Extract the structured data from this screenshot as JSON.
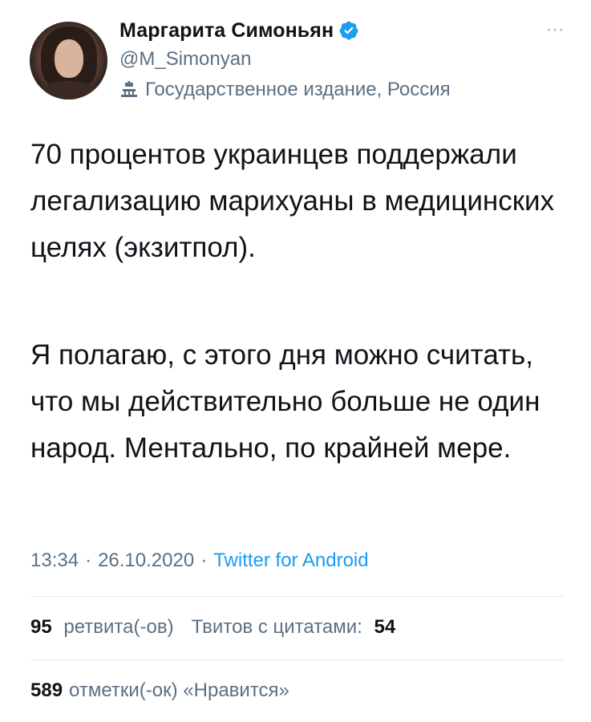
{
  "author": {
    "name": "Маргарита Симоньян",
    "handle": "@M_Simonyan",
    "label": "Государственное издание, Россия",
    "verified_color": "#1d9bf0"
  },
  "more_menu": "···",
  "tweet": {
    "paragraph1": "70 процентов украинцев поддержали легализацию марихуаны в медицинских целях (экзитпол).",
    "paragraph2": "Я полагаю, с этого дня можно считать, что мы действительно больше не один народ. Ментально, по крайней мере."
  },
  "meta": {
    "time": "13:34",
    "date": "26.10.2020",
    "separator": "·",
    "source": "Twitter for Android"
  },
  "stats": {
    "retweets_count": "95",
    "retweets_label": "ретвита(-ов)",
    "quotes_label": "Твитов с цитатами:",
    "quotes_count": "54",
    "likes_count": "589",
    "likes_label": "отметки(-ок) «Нравится»"
  },
  "icons": {
    "verified": "verified-badge-icon",
    "label": "government-building-icon",
    "more": "more-options-icon"
  }
}
